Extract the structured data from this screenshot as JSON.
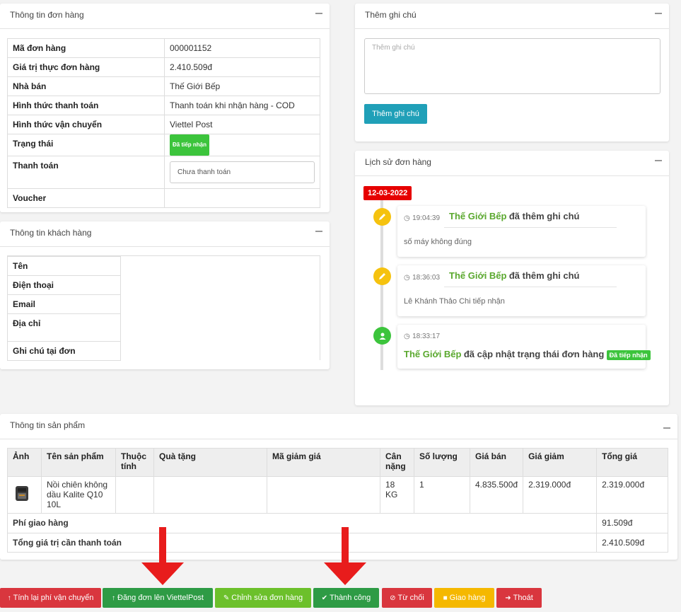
{
  "order_info": {
    "title": "Thông tin đơn hàng",
    "rows": [
      {
        "label": "Mã đơn hàng",
        "value": "000001152"
      },
      {
        "label": "Giá trị thực đơn hàng",
        "value": "2.410.509đ"
      },
      {
        "label": "Nhà bán",
        "value": "Thế Giới Bếp"
      },
      {
        "label": "Hình thức thanh toán",
        "value": "Thanh toán khi nhận hàng - COD"
      },
      {
        "label": "Hình thức vận chuyển",
        "value": "Viettel Post"
      },
      {
        "label": "Trạng thái",
        "value": "Đã tiếp nhận"
      },
      {
        "label": "Thanh toán",
        "value": "Chưa thanh toán"
      },
      {
        "label": "Voucher",
        "value": ""
      }
    ]
  },
  "customer_info": {
    "title": "Thông tin khách hàng",
    "rows": [
      "Tên",
      "Điện thoại",
      "Email",
      "Địa chỉ",
      "Ghi chú tại đơn"
    ]
  },
  "add_note": {
    "title": "Thêm ghi chú",
    "placeholder": "Thêm ghi chú",
    "button": "Thêm ghi chú"
  },
  "history": {
    "title": "Lịch sử đơn hàng",
    "date": "12-03-2022",
    "events": [
      {
        "time": "19:04:39",
        "actor": "Thế Giới Bếp",
        "action": "đã thêm ghi chú",
        "body": "số máy không đúng",
        "icon": "pencil-icon",
        "color": "#f5c20f"
      },
      {
        "time": "18:36:03",
        "actor": "Thế Giới Bếp",
        "action": "đã thêm ghi chú",
        "body": "Lê Khánh Thảo Chi tiếp nhận",
        "icon": "pencil-icon",
        "color": "#f5c20f"
      },
      {
        "time": "18:33:17",
        "actor": "Thế Giới Bếp",
        "action": "đã cập nhật trạng thái đơn hàng",
        "badge": "Đã tiếp nhận",
        "icon": "user-icon",
        "color": "#3cc43c"
      }
    ]
  },
  "products": {
    "title": "Thông tin sản phẩm",
    "headers": [
      "Ảnh",
      "Tên sản phẩm",
      "Thuộc tính",
      "Quà tặng",
      "Mã giảm giá",
      "Cân nặng",
      "Số lượng",
      "Giá bán",
      "Giá giảm",
      "Tổng giá"
    ],
    "items": [
      {
        "name": "Nồi chiên không dầu Kalite Q10 10L",
        "attr": "",
        "gift": "",
        "coupon": "",
        "weight": "18 KG",
        "qty": "1",
        "price": "4.835.500đ",
        "discount": "2.319.000đ",
        "total": "2.319.000đ"
      }
    ],
    "shipping_label": "Phí giao hàng",
    "shipping_value": "91.509đ",
    "grand_label": "Tổng giá trị cần thanh toán",
    "grand_value": "2.410.509đ"
  },
  "actions": [
    {
      "label": "Tính lại phí vận chuyển",
      "color": "#d9363e"
    },
    {
      "label": "Đăng đơn lên ViettelPost",
      "color": "#2e9b45"
    },
    {
      "label": "Chỉnh sửa đơn hàng",
      "color": "#6cc02b"
    },
    {
      "label": "Thành công",
      "color": "#2e9b45"
    },
    {
      "label": "Từ chối",
      "color": "#d9363e"
    },
    {
      "label": "Giao hàng",
      "color": "#f5b800"
    },
    {
      "label": "Thoát",
      "color": "#d9363e"
    }
  ]
}
